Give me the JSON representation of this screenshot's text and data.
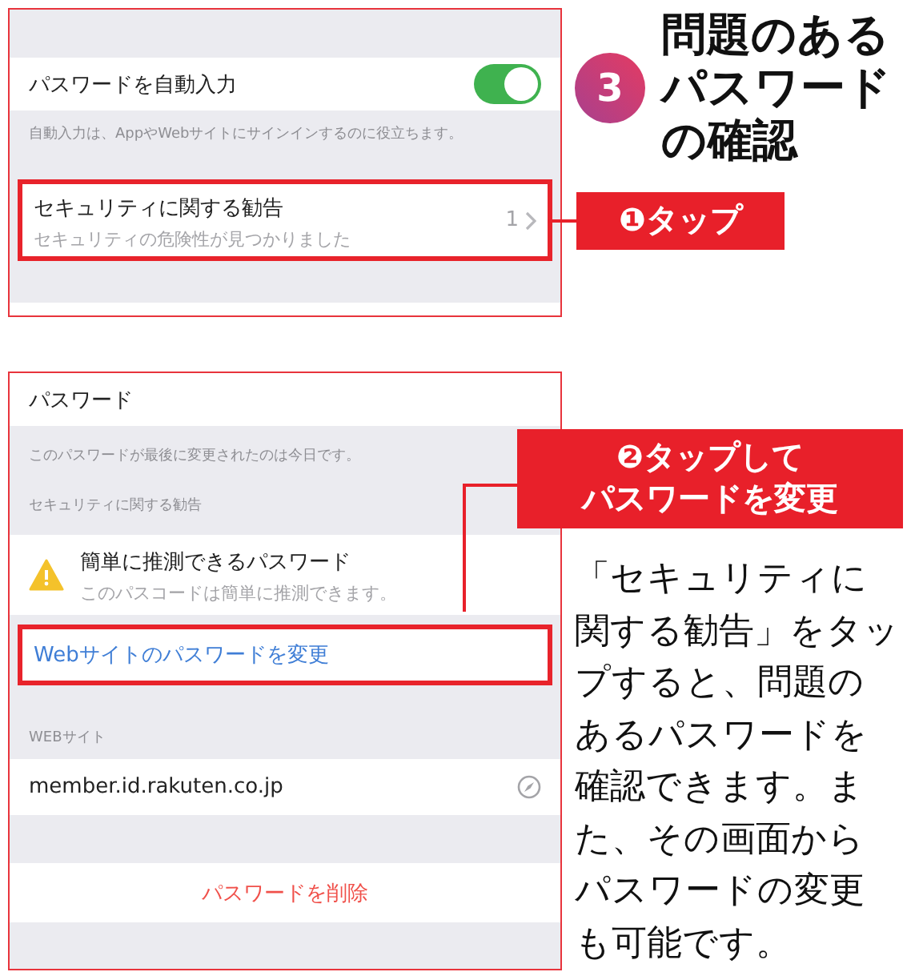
{
  "step": {
    "number": "3",
    "title_lines": [
      "問題のある",
      "パスワード",
      "の確認"
    ]
  },
  "screen_1": {
    "autofill": {
      "label": "パスワードを自動入力",
      "on": true
    },
    "autofill_note": "自動入力は、AppやWebサイトにサインインするのに役立ちます。",
    "security_row": {
      "title": "セキュリティに関する勧告",
      "subtitle": "セキュリティの危険性が見つかりました",
      "count": "1",
      "highlighted": true
    }
  },
  "screen_2": {
    "title": "パスワード",
    "note": "このパスワードが最後に変更されたのは今日です。",
    "section_header": "セキュリティに関する勧告",
    "warning": {
      "title": "簡単に推測できるパスワード",
      "subtitle": "このパスコードは簡単に推測できます。"
    },
    "change_link": {
      "label": "Webサイトのパスワードを変更",
      "highlighted": true
    },
    "website_header": "WEBサイト",
    "website": "member.id.rakuten.co.jp",
    "delete_button": "パスワードを削除"
  },
  "callouts": [
    {
      "lines": [
        "❶タップ"
      ]
    },
    {
      "lines": [
        "❷タップして",
        "パスワードを変更"
      ]
    }
  ],
  "description_lines": [
    "「セキュリティに",
    "関する勧告」をタッ",
    "プすると、問題の",
    "あるパスワードを",
    "確認できます。ま",
    "た、その画面から",
    "パスワードの変更",
    "も可能です。"
  ]
}
